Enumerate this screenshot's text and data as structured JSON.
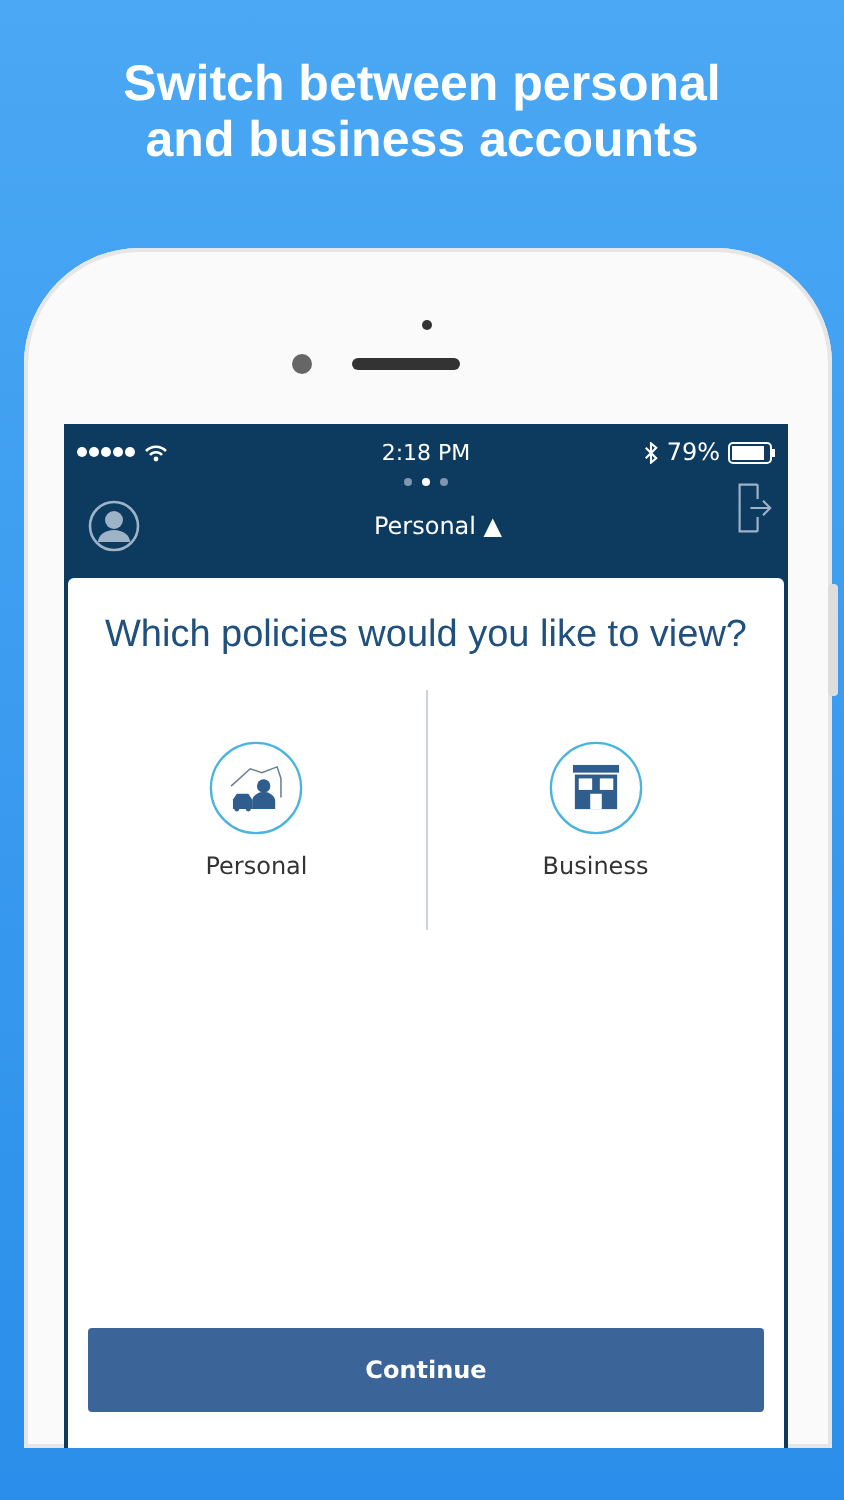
{
  "headline": [
    "Switch between personal",
    "and business accounts"
  ],
  "status_bar": {
    "time": "2:18 PM",
    "battery": "79%"
  },
  "page_dots": [
    {
      "selected": false
    },
    {
      "selected": true
    },
    {
      "selected": false
    }
  ],
  "account_switcher": {
    "label": "Personal",
    "symbol": "▲"
  },
  "question": "Which policies would you like to view?",
  "options": [
    {
      "kind": "personal",
      "label": "Personal"
    },
    {
      "kind": "business",
      "label": "Business"
    }
  ],
  "continue_button": "Continue"
}
